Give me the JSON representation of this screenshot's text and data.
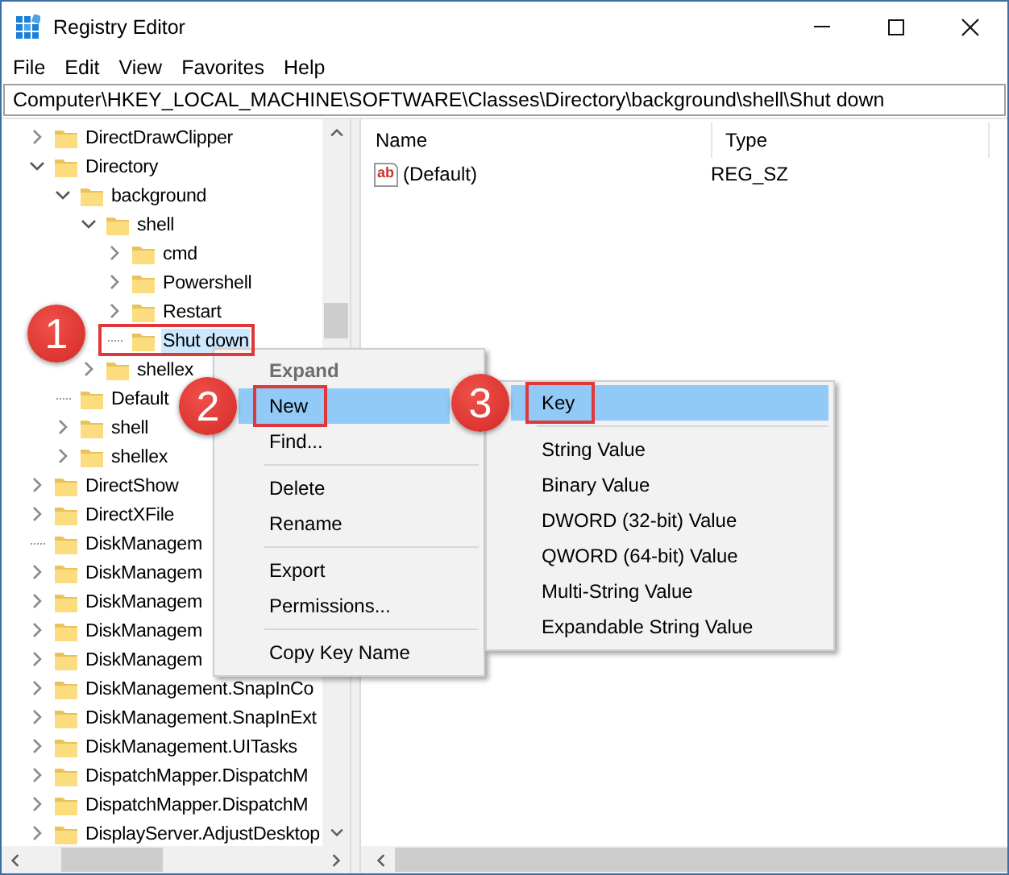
{
  "window": {
    "title": "Registry Editor"
  },
  "menu_bar": [
    "File",
    "Edit",
    "View",
    "Favorites",
    "Help"
  ],
  "address": "Computer\\HKEY_LOCAL_MACHINE\\SOFTWARE\\Classes\\Directory\\background\\shell\\Shut down",
  "tree": [
    {
      "label": "DirectDrawClipper",
      "expanded": false,
      "leaf": false,
      "selected": false
    },
    {
      "label": "Directory",
      "expanded": true,
      "leaf": false,
      "selected": false,
      "children": [
        {
          "label": "background",
          "expanded": true,
          "leaf": false,
          "selected": false,
          "children": [
            {
              "label": "shell",
              "expanded": true,
              "leaf": false,
              "selected": false,
              "children": [
                {
                  "label": "cmd",
                  "expanded": false,
                  "leaf": false,
                  "selected": false
                },
                {
                  "label": "Powershell",
                  "expanded": false,
                  "leaf": false,
                  "selected": false
                },
                {
                  "label": "Restart",
                  "expanded": false,
                  "leaf": false,
                  "selected": false
                },
                {
                  "label": "Shut down",
                  "leaf": true,
                  "selected": true,
                  "callout": "1"
                }
              ]
            },
            {
              "label": "shellex",
              "expanded": false,
              "leaf": false,
              "selected": false
            }
          ]
        },
        {
          "label": "Default",
          "leaf": true,
          "selected": false
        },
        {
          "label": "shell",
          "expanded": false,
          "leaf": false,
          "selected": false
        },
        {
          "label": "shellex",
          "expanded": false,
          "leaf": false,
          "selected": false
        }
      ]
    },
    {
      "label": "DirectShow",
      "expanded": false,
      "leaf": false,
      "selected": false
    },
    {
      "label": "DirectXFile",
      "expanded": false,
      "leaf": false,
      "selected": false
    },
    {
      "label": "DiskManagem",
      "leaf": true,
      "selected": false
    },
    {
      "label": "DiskManagem",
      "expanded": false,
      "leaf": false,
      "selected": false
    },
    {
      "label": "DiskManagem",
      "expanded": false,
      "leaf": false,
      "selected": false
    },
    {
      "label": "DiskManagem",
      "expanded": false,
      "leaf": false,
      "selected": false
    },
    {
      "label": "DiskManagem",
      "expanded": false,
      "leaf": false,
      "selected": false
    },
    {
      "label": "DiskManagement.SnapInCo",
      "expanded": false,
      "leaf": false,
      "selected": false
    },
    {
      "label": "DiskManagement.SnapInExt",
      "expanded": false,
      "leaf": false,
      "selected": false
    },
    {
      "label": "DiskManagement.UITasks",
      "expanded": false,
      "leaf": false,
      "selected": false
    },
    {
      "label": "DispatchMapper.DispatchM",
      "expanded": false,
      "leaf": false,
      "selected": false
    },
    {
      "label": "DispatchMapper.DispatchM",
      "expanded": false,
      "leaf": false,
      "selected": false
    },
    {
      "label": "DisplayServer.AdjustDesktop",
      "expanded": false,
      "leaf": false,
      "selected": false
    }
  ],
  "values_list": {
    "columns": [
      "Name",
      "Type"
    ],
    "rows": [
      {
        "icon": "ab",
        "name": "(Default)",
        "type": "REG_SZ"
      }
    ]
  },
  "context_menu": {
    "items": [
      {
        "kind": "item",
        "label": "Expand",
        "bold": true,
        "disabled": true,
        "selected": false
      },
      {
        "kind": "item",
        "label": "New",
        "bold": false,
        "disabled": false,
        "selected": true,
        "callout": "2"
      },
      {
        "kind": "item",
        "label": "Find...",
        "bold": false,
        "disabled": false,
        "selected": false
      },
      {
        "kind": "separator"
      },
      {
        "kind": "item",
        "label": "Delete",
        "bold": false,
        "disabled": false,
        "selected": false
      },
      {
        "kind": "item",
        "label": "Rename",
        "bold": false,
        "disabled": false,
        "selected": false
      },
      {
        "kind": "separator"
      },
      {
        "kind": "item",
        "label": "Export",
        "bold": false,
        "disabled": false,
        "selected": false
      },
      {
        "kind": "item",
        "label": "Permissions...",
        "bold": false,
        "disabled": false,
        "selected": false
      },
      {
        "kind": "separator"
      },
      {
        "kind": "item",
        "label": "Copy Key Name",
        "bold": false,
        "disabled": false,
        "selected": false
      }
    ]
  },
  "submenu": {
    "items": [
      {
        "kind": "item",
        "label": "Key",
        "bold": false,
        "disabled": false,
        "selected": true,
        "callout": "3"
      },
      {
        "kind": "separator"
      },
      {
        "kind": "item",
        "label": "String Value",
        "bold": false,
        "disabled": false,
        "selected": false
      },
      {
        "kind": "item",
        "label": "Binary Value",
        "bold": false,
        "disabled": false,
        "selected": false
      },
      {
        "kind": "item",
        "label": "DWORD (32-bit) Value",
        "bold": false,
        "disabled": false,
        "selected": false
      },
      {
        "kind": "item",
        "label": "QWORD (64-bit) Value",
        "bold": false,
        "disabled": false,
        "selected": false
      },
      {
        "kind": "item",
        "label": "Multi-String Value",
        "bold": false,
        "disabled": false,
        "selected": false
      },
      {
        "kind": "item",
        "label": "Expandable String Value",
        "bold": false,
        "disabled": false,
        "selected": false
      }
    ]
  }
}
